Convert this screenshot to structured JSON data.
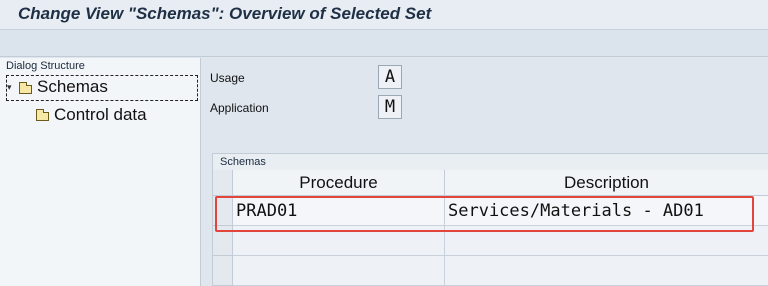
{
  "window": {
    "title": "Change View \"Schemas\": Overview of Selected Set"
  },
  "dialog_structure": {
    "title": "Dialog Structure",
    "items": [
      {
        "label": "Schemas",
        "icon": "folder-open-icon",
        "selected": true,
        "expanded": true
      },
      {
        "label": "Control data",
        "icon": "folder-icon",
        "selected": false
      }
    ]
  },
  "fields": {
    "usage": {
      "label": "Usage",
      "value": "A"
    },
    "application": {
      "label": "Application",
      "value": "M"
    }
  },
  "schemas_table": {
    "caption": "Schemas",
    "columns": [
      "Procedure",
      "Description"
    ],
    "rows": [
      [
        "PRAD01",
        "Services/Materials - AD01"
      ]
    ]
  },
  "colors": {
    "highlight": "#e2453c",
    "title_text": "#1f2f45"
  }
}
